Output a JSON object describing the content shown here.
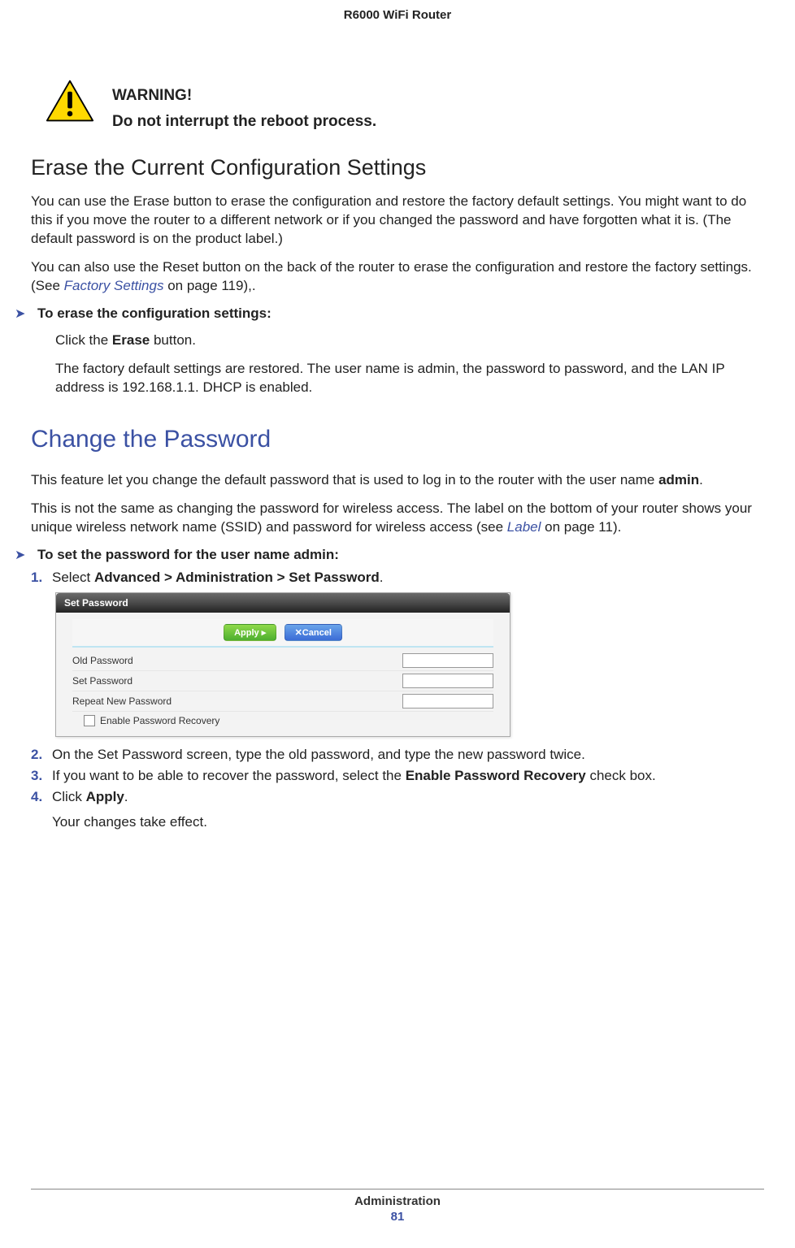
{
  "header": {
    "title": "R6000 WiFi Router"
  },
  "warning": {
    "label": "WARNING!",
    "body": "Do not interrupt the reboot process."
  },
  "section1": {
    "heading": "Erase the Current Configuration Settings",
    "p1": "You can use the Erase button to erase the configuration and restore the factory default settings. You might want to do this if you move the router to a different network or if you changed the password and have forgotten what it is. (The default password is on the product label.)",
    "p2a": "You can also use the Reset button on the back of the router to erase the configuration and restore the factory settings. (See ",
    "p2link": "Factory Settings",
    "p2b": " on page 119),.",
    "procTitle": "To erase the configuration settings:",
    "step1a": "Click the ",
    "step1b": "Erase",
    "step1c": " button.",
    "step1res": "The factory default settings are restored. The user name is admin, the password to password, and the LAN IP address is 192.168.1.1. DHCP is enabled."
  },
  "section2": {
    "heading": "Change the Password",
    "p1a": "This feature let you change the default password that is used to log in to the router with the user name ",
    "p1b": "admin",
    "p1c": ".",
    "p2a": "This is not the same as changing the password for wireless access. The label on the bottom of your router shows your unique wireless network name (SSID) and password for wireless access (see ",
    "p2link": "Label",
    "p2b": " on page 11).",
    "procTitle": "To set the password for the user name admin:",
    "step1a": "Select ",
    "step1b": "Advanced > Administration > Set Password",
    "step1c": ".",
    "step2": "On the Set Password screen, type the old password, and type the new password twice.",
    "step3a": "If you want to be able to recover the password, select the ",
    "step3b": "Enable Password Recovery",
    "step3c": " check box.",
    "step4a": "Click ",
    "step4b": "Apply",
    "step4c": ".",
    "step4res": "Your changes take effect."
  },
  "ui": {
    "title": "Set Password",
    "apply": "Apply ▸",
    "cancel": "✕Cancel",
    "oldPassword": "Old Password",
    "setPassword": "Set Password",
    "repeatNew": "Repeat New Password",
    "enableRecovery": "Enable Password Recovery"
  },
  "footer": {
    "section": "Administration",
    "page": "81"
  },
  "nums": {
    "n1": "1.",
    "n2": "2.",
    "n3": "3.",
    "n4": "4."
  }
}
